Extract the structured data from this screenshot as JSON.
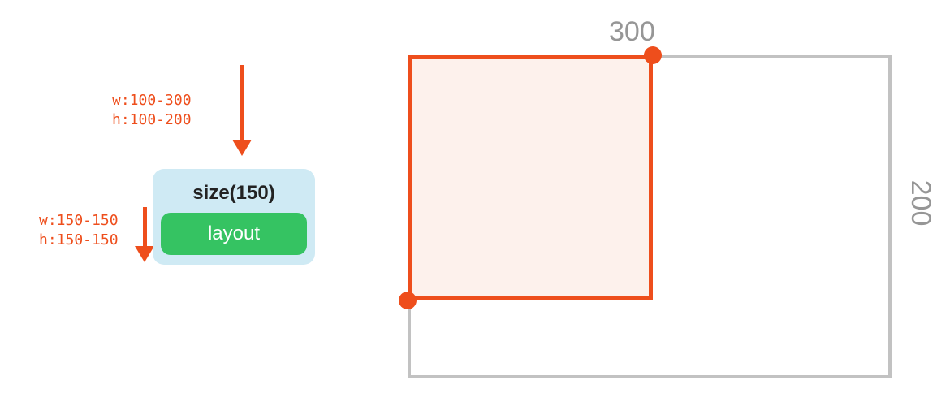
{
  "constraints": {
    "incoming": {
      "w": "w:100-300",
      "h": "h:100-200"
    },
    "outgoing": {
      "w": "w:150-150",
      "h": "h:150-150"
    }
  },
  "node": {
    "title": "size(150)",
    "child_label": "layout"
  },
  "viz": {
    "container_width_label": "300",
    "container_height_label": "200",
    "container_width": 300,
    "container_height": 200,
    "child_width": 150,
    "child_height": 150
  },
  "colors": {
    "accent": "#ee4e1c",
    "node_bg": "#cfeaf4",
    "child_bg": "#35c362",
    "grey": "#c2c2c2"
  }
}
